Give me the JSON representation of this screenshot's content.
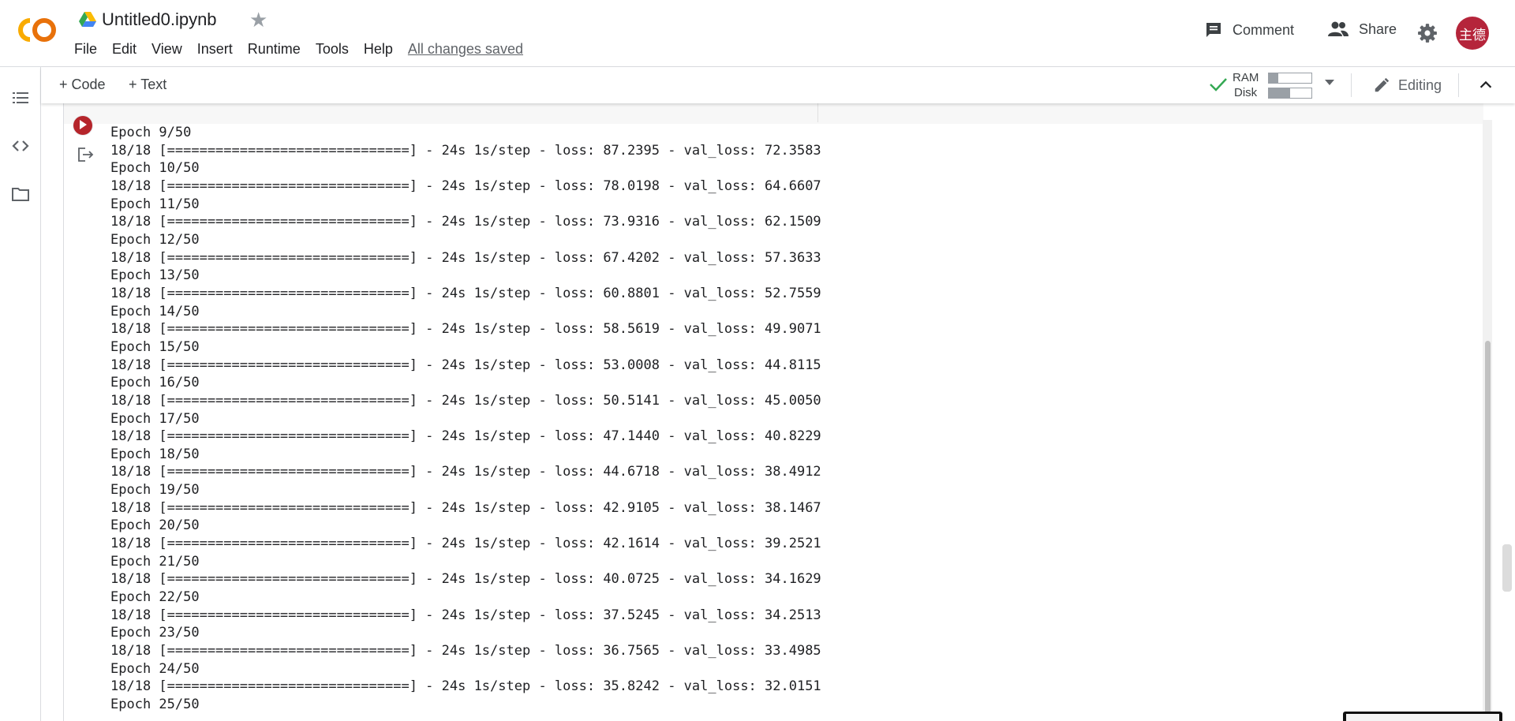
{
  "app": {
    "title": "Untitled0.ipynb",
    "menu": [
      "File",
      "Edit",
      "View",
      "Insert",
      "Runtime",
      "Tools",
      "Help"
    ],
    "save_status": "All changes saved",
    "comment_label": "Comment",
    "share_label": "Share",
    "user_initials": "主德"
  },
  "toolbar": {
    "add_code": "+ Code",
    "add_text": "+ Text",
    "ram_label": "RAM",
    "disk_label": "Disk",
    "ram_usage": 0.22,
    "disk_usage": 0.5,
    "editing_label": "Editing"
  },
  "colors": {
    "accent_orange": "#F9AB00",
    "run_button": "#B5252B",
    "avatar_bg": "#B5253B",
    "check_green": "#34A853"
  },
  "icons": {
    "left_rail": [
      "toc-icon",
      "code-snippets-icon",
      "files-icon"
    ],
    "header": [
      "drive-icon",
      "star-icon",
      "comment-icon",
      "share-icon",
      "settings-icon"
    ]
  },
  "output": {
    "lines": [
      "Epoch 9/50",
      "18/18 [==============================] - 24s 1s/step - loss: 87.2395 - val_loss: 72.3583",
      "Epoch 10/50",
      "18/18 [==============================] - 24s 1s/step - loss: 78.0198 - val_loss: 64.6607",
      "Epoch 11/50",
      "18/18 [==============================] - 24s 1s/step - loss: 73.9316 - val_loss: 62.1509",
      "Epoch 12/50",
      "18/18 [==============================] - 24s 1s/step - loss: 67.4202 - val_loss: 57.3633",
      "Epoch 13/50",
      "18/18 [==============================] - 24s 1s/step - loss: 60.8801 - val_loss: 52.7559",
      "Epoch 14/50",
      "18/18 [==============================] - 24s 1s/step - loss: 58.5619 - val_loss: 49.9071",
      "Epoch 15/50",
      "18/18 [==============================] - 24s 1s/step - loss: 53.0008 - val_loss: 44.8115",
      "Epoch 16/50",
      "18/18 [==============================] - 24s 1s/step - loss: 50.5141 - val_loss: 45.0050",
      "Epoch 17/50",
      "18/18 [==============================] - 24s 1s/step - loss: 47.1440 - val_loss: 40.8229",
      "Epoch 18/50",
      "18/18 [==============================] - 24s 1s/step - loss: 44.6718 - val_loss: 38.4912",
      "Epoch 19/50",
      "18/18 [==============================] - 24s 1s/step - loss: 42.9105 - val_loss: 38.1467",
      "Epoch 20/50",
      "18/18 [==============================] - 24s 1s/step - loss: 42.1614 - val_loss: 39.2521",
      "Epoch 21/50",
      "18/18 [==============================] - 24s 1s/step - loss: 40.0725 - val_loss: 34.1629",
      "Epoch 22/50",
      "18/18 [==============================] - 24s 1s/step - loss: 37.5245 - val_loss: 34.2513",
      "Epoch 23/50",
      "18/18 [==============================] - 24s 1s/step - loss: 36.7565 - val_loss: 33.4985",
      "Epoch 24/50",
      "18/18 [==============================] - 24s 1s/step - loss: 35.8242 - val_loss: 32.0151",
      "Epoch 25/50"
    ]
  }
}
